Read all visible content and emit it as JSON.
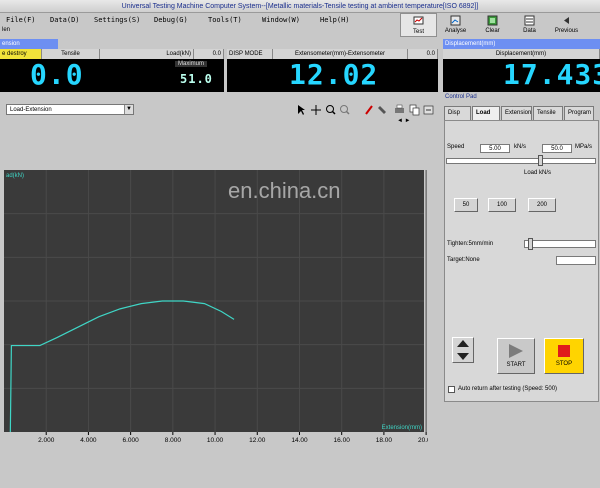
{
  "window": {
    "title": "Universal Testing Machine Computer System--[Metallic materials-Tensile testing at ambient temperature[ISO 6892]]"
  },
  "menu": {
    "items": [
      "File(F)",
      "Data(D)",
      "Settings(S)",
      "Debug(G)",
      "Tools(T)",
      "Window(W)",
      "Help(H)"
    ],
    "sub": "len"
  },
  "toolbar": {
    "buttons": [
      "Test",
      "Analyse",
      "Clear",
      "Data",
      "Previous"
    ]
  },
  "top_labels": {
    "left": "ension",
    "right": "Displacement(mm)"
  },
  "panels": {
    "load": {
      "tags": [
        "e destroy",
        "Tensile",
        "Load(kN)",
        "0.0"
      ],
      "value": "0.0",
      "max_label": "Maximum",
      "max_value": "51.0"
    },
    "extensometer": {
      "tags": [
        "DISP MODE",
        "Extensometer(mm)-Extensometer",
        "0.0"
      ],
      "value": "12.02"
    },
    "displacement": {
      "caption": "Displacement(mm)",
      "value": "17.433"
    }
  },
  "chart_window": {
    "selector": "Load-Extension",
    "y_unit": "ad(kN)",
    "x_unit": "Extension(mm)"
  },
  "chart_data": {
    "type": "line",
    "xlabel": "Extension(mm)",
    "ylabel": "ad(kN)",
    "x_ticks": [
      "2.000",
      "4.000",
      "6.000",
      "8.000",
      "10.00",
      "12.00",
      "14.00",
      "16.00",
      "18.00",
      "20.00"
    ],
    "xlim": [
      0,
      19.9
    ],
    "series": [
      {
        "x": [
          0.3,
          0.35,
          1.7,
          2.5,
          3.5,
          4.5,
          5.5,
          6.5,
          7.5,
          8.5,
          9.5,
          10.3,
          10.9
        ],
        "y": [
          0.0,
          0.33,
          0.33,
          0.36,
          0.4,
          0.44,
          0.47,
          0.49,
          0.5,
          0.5,
          0.49,
          0.46,
          0.43
        ]
      }
    ],
    "line_color": "#3fd6c6",
    "background": "#3a3a3a",
    "grid": true
  },
  "control_pad": {
    "title": "Control Pad",
    "tabs": [
      "Disp",
      "Load",
      "Extension",
      "Tensile",
      "Program"
    ],
    "speed_label": "Speed",
    "speed_value": "5.00",
    "speed_unit": "kN/s",
    "rate_value": "50.0",
    "rate_unit": "MPa/s",
    "step_label": "Load kN/s",
    "steps": [
      "50",
      "100",
      "200"
    ],
    "tighten_label": "Tighten:5mm/min",
    "target_label": "Target:None",
    "start_label": "START",
    "stop_label": "STOP",
    "auto_return_label": "Auto return after testing (Speed: 500)"
  },
  "watermark": "en.china.cn"
}
